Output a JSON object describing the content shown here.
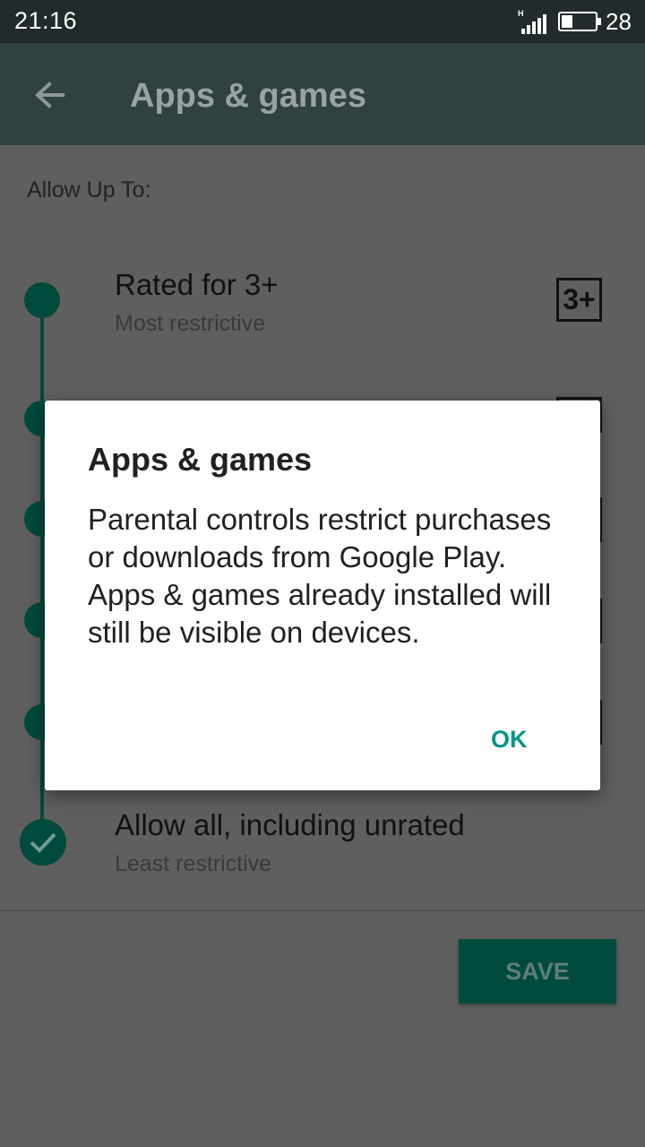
{
  "status_bar": {
    "time": "21:16",
    "network_label": "H",
    "battery_level": "28",
    "icons": [
      "signal-icon",
      "battery-icon"
    ]
  },
  "app_bar": {
    "title": "Apps & games",
    "back_icon": "back-arrow-icon"
  },
  "content": {
    "allow_label": "Allow Up To:",
    "ratings": [
      {
        "title": "Rated for 3+",
        "subtitle": "Most restrictive",
        "badge": "3+"
      },
      {
        "title": "Allow all, including unrated",
        "subtitle": "Least restrictive",
        "selected": true
      }
    ],
    "save_label": "SAVE"
  },
  "dialog": {
    "title": "Apps & games",
    "body": "Parental controls restrict purchases or downloads from Google Play. Apps & games already installed will still be visible on devices.",
    "ok_label": "OK"
  },
  "colors": {
    "status_bar": "#222b2b",
    "app_bar": "#2f4141",
    "accent": "#014a3e",
    "dialog_action": "#009587",
    "scrim_content": "#5f5f5f"
  }
}
